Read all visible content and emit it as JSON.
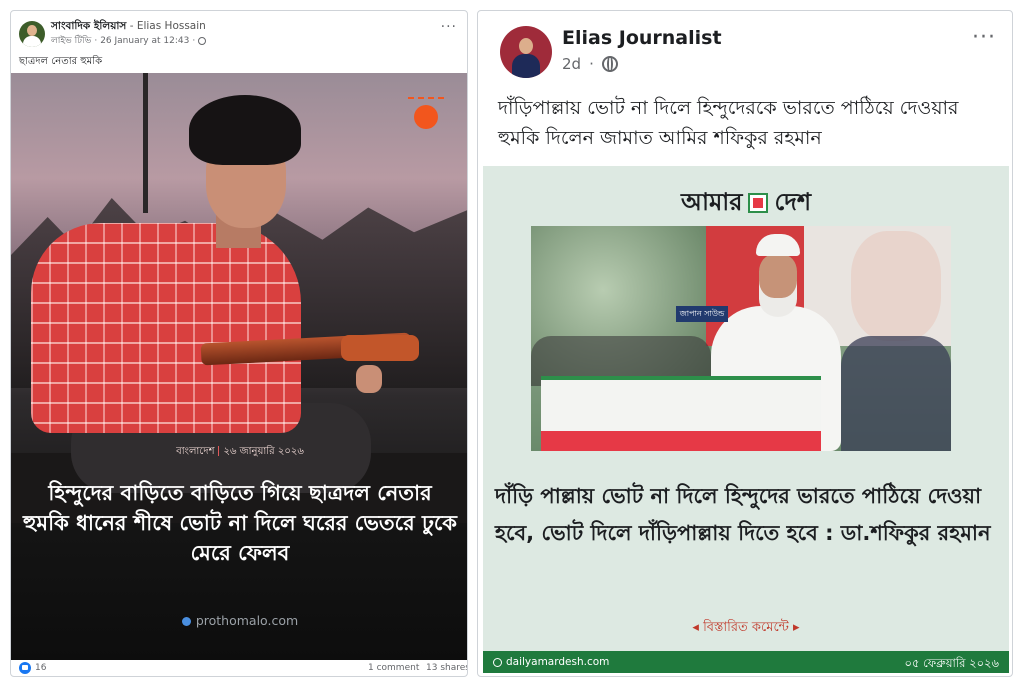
{
  "left_post": {
    "author_name": "সাংবাদিক ইলিয়াস",
    "author_sub": " - Elias Hossain",
    "meta_label": "লাইভ টিভি",
    "timestamp": "26 January at 12:43",
    "more_label": "···",
    "caption": "ছাত্রদল নেতার হুমকি",
    "image": {
      "dateline_region": "বাংলাদেশ",
      "dateline_date": "২৬ জানুয়ারি ২০২৬",
      "headline": "হিন্দুদের বাড়িতে বাড়িতে গিয়ে ছাত্রদল নেতার হুমকি ধানের শীষে ভোট না দিলে ঘরের ভেতরে ঢুকে মেরে ফেলব",
      "source": "prothomalo.com"
    },
    "footer": {
      "likes": "16",
      "comments": "1 comment",
      "shares": "13 shares"
    }
  },
  "right_post": {
    "author_name": "Elias Journalist",
    "timestamp": "2d",
    "more_label": "···",
    "caption": "দাঁড়িপাল্লায় ভোট না দিলে হিন্দুদেরকে ভারতে পাঠিয়ে দেওয়ার হুমকি দিলেন জামাত আমির শফিকুর রহমান",
    "card": {
      "brand_left": "আমার",
      "brand_right": "দেশ",
      "photo_sign": "জাপান সাউন্ড",
      "headline": "দাঁড়ি পাল্লায় ভোট না দিলে হিন্দুদের ভারতে পাঠিয়ে দেওয়া হবে, ভোট দিলে দাঁড়িপাল্লায় দিতে হবে : ডা.শফিকুর রহমান",
      "details_link": "◂ বিস্তারিত কমেন্টে ▸",
      "site": "dailyamardesh.com",
      "date": "০৫ ফেব্রুয়ারি ২০২৬"
    }
  },
  "colors": {
    "accent_red": "#e63946",
    "brand_green": "#1f7a3d",
    "card_bg": "#dde9e2",
    "facebook_blue": "#1877f2",
    "sun_orange": "#f2561d"
  }
}
